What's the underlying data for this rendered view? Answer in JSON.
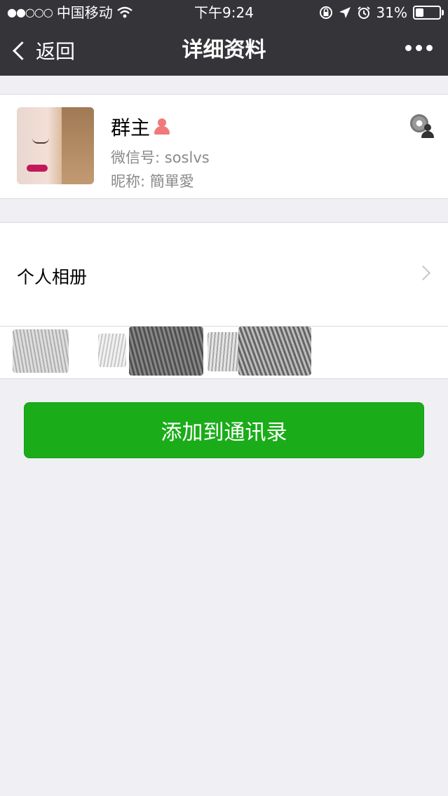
{
  "status_bar": {
    "signal": "●●○○○",
    "carrier": "中国移动",
    "time": "下午9:24",
    "battery": "31%",
    "battery_level": 0.31
  },
  "nav": {
    "back_label": "返回",
    "title": "详细资料"
  },
  "profile": {
    "name": "群主",
    "wechat_label": "微信号:",
    "wechat_id": "soslvs",
    "nick_label": "昵称:",
    "nickname": "簡單愛"
  },
  "album": {
    "label": "个人相册"
  },
  "actions": {
    "add_contact_label": "添加到通讯录"
  },
  "colors": {
    "nav_bg": "#353539",
    "page_bg": "#efeff4",
    "button_green": "#1aad19",
    "gender_icon": "#f07a7a"
  },
  "icons": {
    "back": "chevron-left-icon",
    "more": "more-dots-icon",
    "wifi": "wifi-icon",
    "lock": "orientation-lock-icon",
    "location": "location-arrow-icon",
    "alarm": "alarm-icon",
    "battery": "battery-icon",
    "gender": "female-icon",
    "moments": "moments-camera-icon",
    "album_chevron": "chevron-right-icon"
  }
}
